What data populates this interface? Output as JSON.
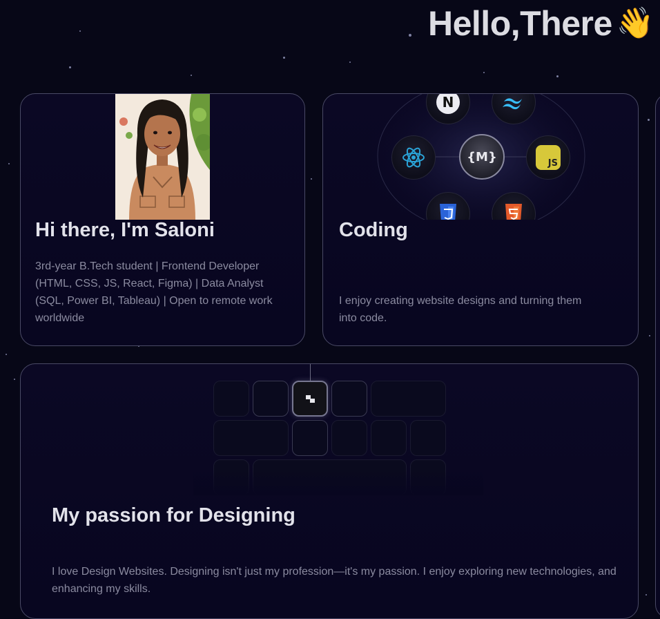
{
  "hero": {
    "title": "Hello,There",
    "emoji": "👋"
  },
  "about": {
    "title": "Hi there, I'm Saloni",
    "description": "3rd-year B.Tech student | Frontend Developer (HTML, CSS, JS, React, Figma) | Data Analyst (SQL, Power BI, Tableau) | Open to remote work worldwide"
  },
  "coding": {
    "title": "Coding",
    "description": "I enjoy creating website designs and turning them into code.",
    "tech_icons": [
      "nextjs-icon",
      "tailwind-icon",
      "react-icon",
      "markdown-icon",
      "javascript-icon",
      "css3-icon",
      "html5-icon"
    ],
    "js_label": "JS",
    "next_label": "N",
    "center_label": "{M}"
  },
  "design": {
    "title": "My passion for Designing",
    "description": "I love Design Websites. Designing isn't just my profession—it's my passion. I enjoy exploring new technologies, and enhancing my skills."
  },
  "colors": {
    "background": "#070717",
    "card_border": "#4a4a66",
    "muted_text": "#8b8ba0",
    "js_yellow": "#d7c83a",
    "react_blue": "#2aa4d8",
    "html_orange": "#e35a2a",
    "css_blue": "#2a63d8"
  }
}
